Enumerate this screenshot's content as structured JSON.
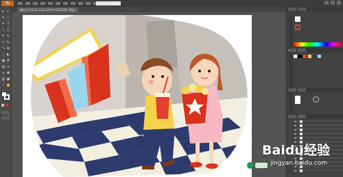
{
  "app": {
    "logo_text": "Ai"
  },
  "document": {
    "tab_label": "插图_2*23:01.ai @ 100% (RGB/GPU 预览)"
  },
  "watermark": {
    "brand": "Baidu经验",
    "url": "jingyan.baidu.com"
  },
  "toolbar": {
    "tools": [
      "selection-tool",
      "direct-selection-tool",
      "magic-wand-tool",
      "lasso-tool",
      "pen-tool",
      "type-tool",
      "line-tool",
      "rectangle-tool",
      "paintbrush-tool",
      "pencil-tool",
      "eraser-tool",
      "rotate-tool",
      "scale-tool",
      "width-tool",
      "free-transform-tool",
      "shape-builder-tool",
      "perspective-grid-tool",
      "mesh-tool",
      "gradient-tool",
      "eyedropper-tool",
      "blend-tool",
      "symbol-sprayer-tool",
      "column-graph-tool",
      "artboard-tool",
      "slice-tool",
      "hand-tool",
      "zoom-tool"
    ]
  },
  "colors": {
    "ui_background": "#535353",
    "artboard": "#ffffff",
    "accent_orange": "#c26a1d",
    "marquee_red": "#d9321d",
    "cup_red": "#e2402a",
    "popcorn_yellow": "#f4d34b"
  }
}
